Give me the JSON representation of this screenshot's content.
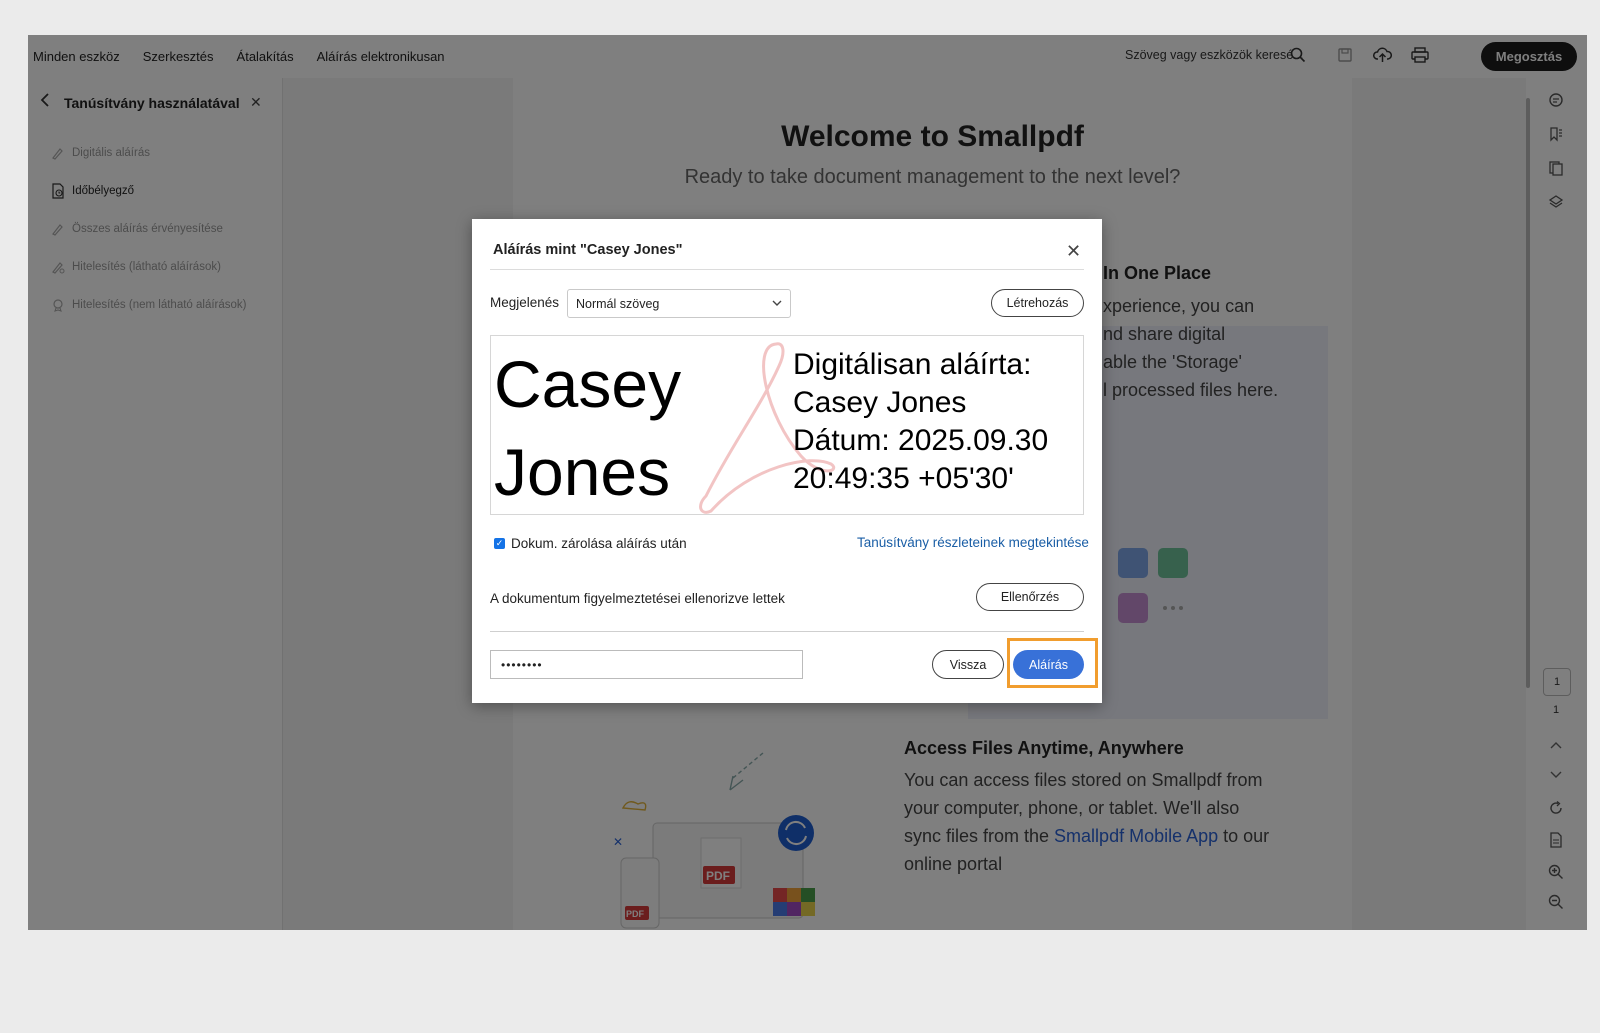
{
  "topbar": {
    "menu": [
      "Minden eszköz",
      "Szerkesztés",
      "Átalakítás",
      "Aláírás elektronikusan"
    ],
    "search_placeholder": "Szöveg vagy eszközök keresé...",
    "share_label": "Megosztás"
  },
  "left_panel": {
    "title": "Tanúsítvány használatával",
    "items": [
      {
        "label": "Digitális aláírás",
        "active": false
      },
      {
        "label": "Időbélyegző",
        "active": true
      },
      {
        "label": "Összes aláírás érvényesítése",
        "active": false
      },
      {
        "label": "Hitelesítés (látható aláírások)",
        "active": false
      },
      {
        "label": "Hitelesítés (nem látható aláírások)",
        "active": false
      }
    ]
  },
  "document": {
    "title": "Welcome to Smallpdf",
    "subtitle": "Ready to take document management to the next level?",
    "section1_heading": "In One Place",
    "section1_lines": [
      "xperience, you can",
      "nd share digital",
      "able the 'Storage'",
      "l processed files here."
    ],
    "section2_heading": "Access Files Anytime, Anywhere",
    "section2_text_1": "You can access files stored on Smallpdf from",
    "section2_text_2": "your computer, phone, or tablet. We'll also",
    "section2_text_3a": "sync files from the ",
    "section2_link": "Smallpdf Mobile App",
    "section2_text_3b": " to our",
    "section2_text_4": "online portal"
  },
  "right_rail": {
    "current_page": "1",
    "total_pages": "1"
  },
  "dialog": {
    "title": "Aláírás mint \"Casey Jones\"",
    "appearance_label": "Megjelenés",
    "appearance_value": "Normál szöveg",
    "create_button": "Létrehozás",
    "preview_name_line1": "Casey",
    "preview_name_line2": "Jones",
    "preview_detail_1": "Digitálisan aláírta:",
    "preview_detail_2": "Casey Jones",
    "preview_detail_3": "Dátum: 2025.09.30",
    "preview_detail_4": "20:49:35 +05'30'",
    "lock_checkbox_label": "Dokum. zárolása aláírás után",
    "lock_checked": true,
    "cert_details_link": "Tanúsítvány részleteinek megtekintése",
    "warnings_text": "A dokumentum figyelmeztetései ellenorizve lettek",
    "check_button": "Ellenőrzés",
    "password_value": "••••••••",
    "back_button": "Vissza",
    "sign_button": "Aláírás"
  },
  "colors": {
    "accent": "#3871d8",
    "highlight": "#f19d2e",
    "link": "#1a5ea6"
  }
}
